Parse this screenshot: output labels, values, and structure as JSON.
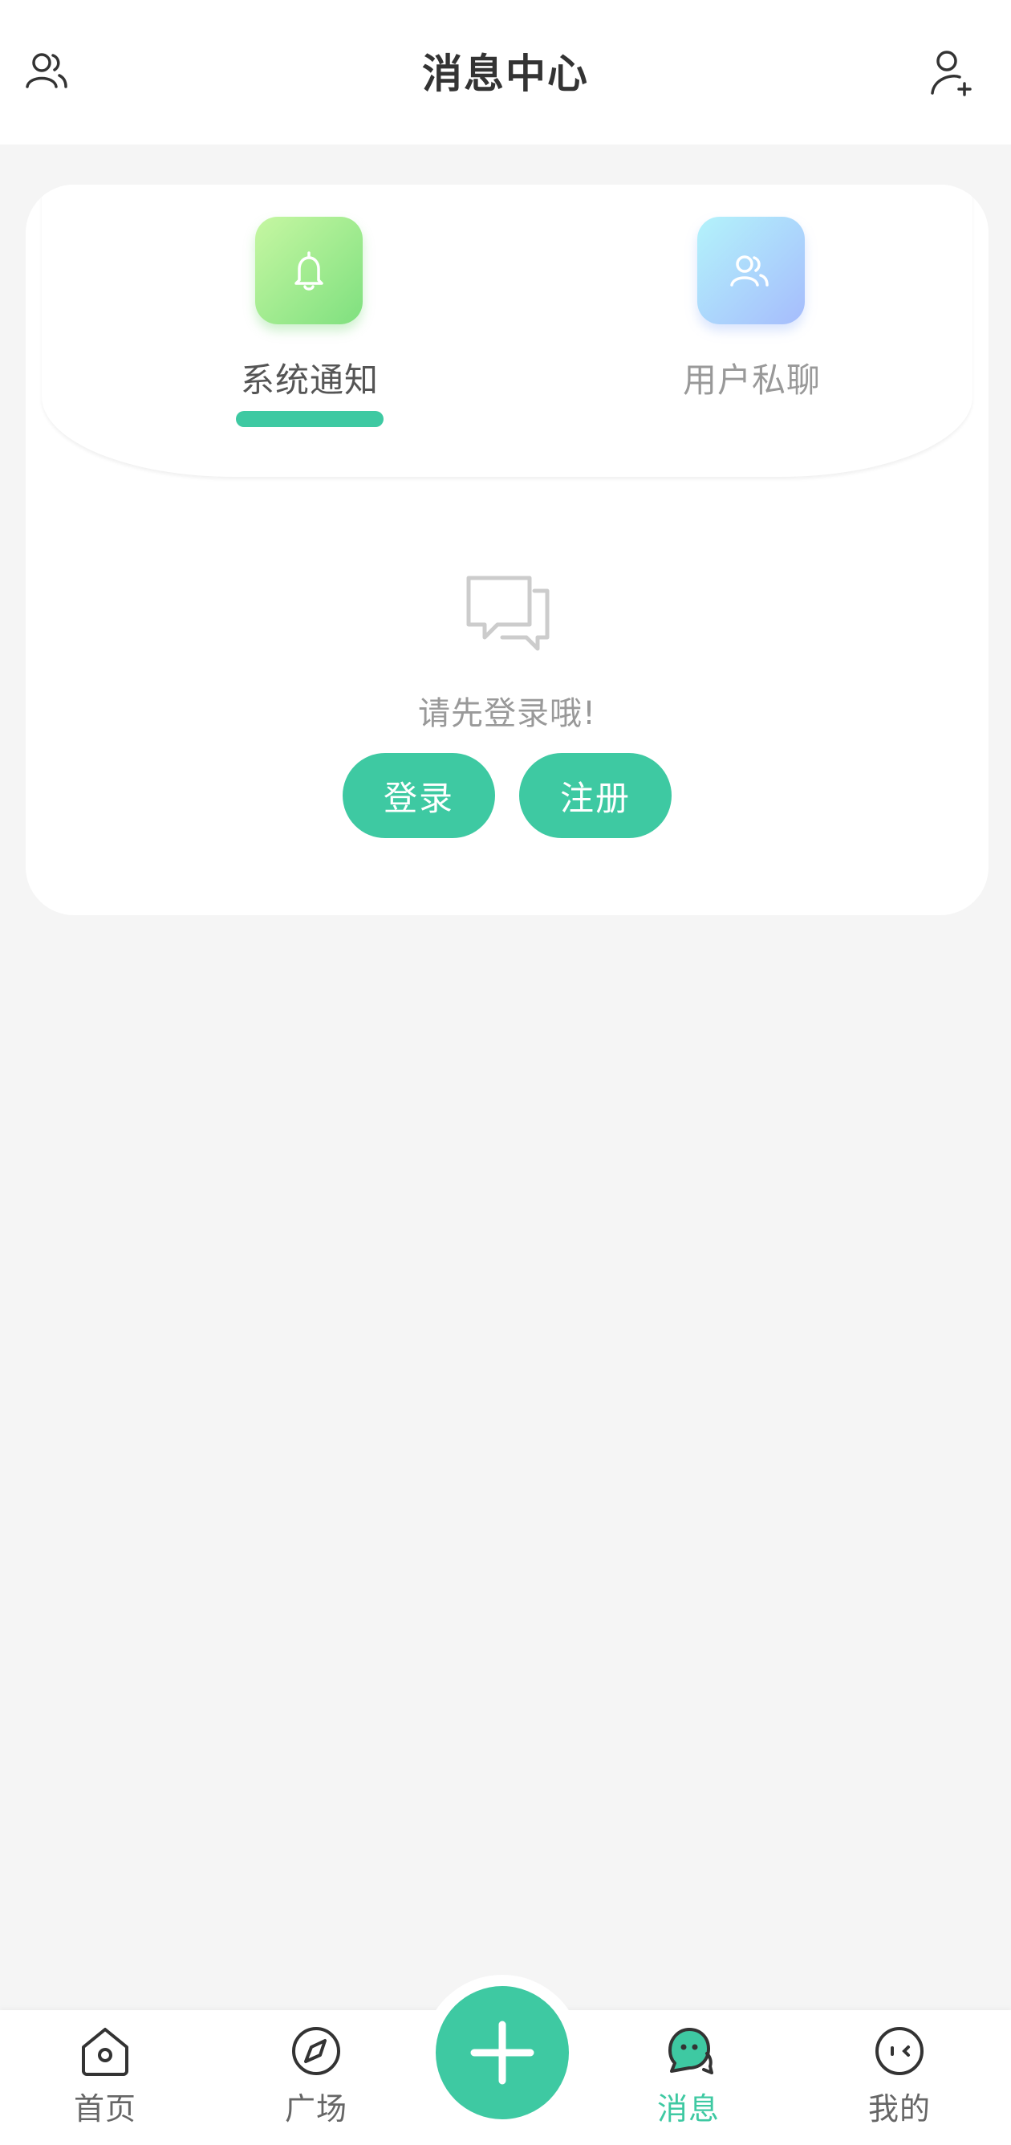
{
  "header": {
    "title": "消息中心",
    "left_icon": "friends-icon",
    "right_icon": "add-user-icon"
  },
  "tabs": [
    {
      "label": "系统通知",
      "icon": "bell-icon",
      "active": true
    },
    {
      "label": "用户私聊",
      "icon": "users-icon",
      "active": false
    }
  ],
  "empty_state": {
    "icon": "chat-bubbles-icon",
    "text": "请先登录哦!",
    "login_label": "登录",
    "register_label": "注册"
  },
  "bottom_nav": {
    "items": [
      {
        "label": "首页",
        "icon": "home-icon",
        "active": false
      },
      {
        "label": "广场",
        "icon": "compass-icon",
        "active": false
      },
      {
        "label": "消息",
        "icon": "message-icon",
        "active": true
      },
      {
        "label": "我的",
        "icon": "face-icon",
        "active": false
      }
    ],
    "fab_icon": "plus-icon"
  },
  "colors": {
    "accent": "#3ec9a2",
    "background": "#f5f5f5",
    "card": "#ffffff",
    "text_primary": "#333333",
    "text_secondary": "#999999"
  }
}
